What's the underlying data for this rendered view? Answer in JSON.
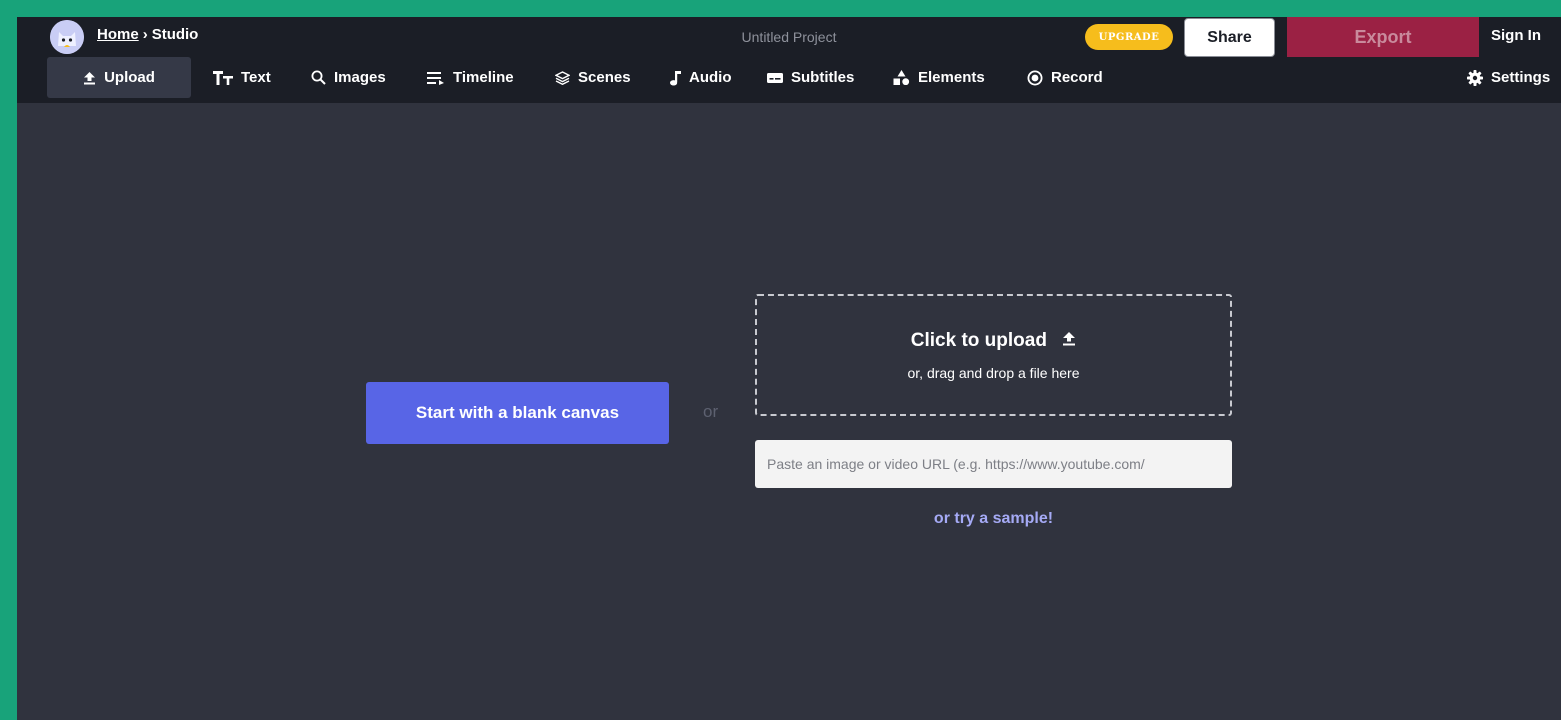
{
  "header": {
    "breadcrumb": {
      "home": "Home",
      "separator": "›",
      "current": "Studio"
    },
    "project_title": "Untitled Project",
    "upgrade_label": "UPGRADE",
    "share_label": "Share",
    "export_label": "Export",
    "signin_label": "Sign In"
  },
  "toolbar": {
    "items": [
      {
        "label": "Upload",
        "icon": "upload-icon",
        "active": true
      },
      {
        "label": "Text",
        "icon": "text-icon"
      },
      {
        "label": "Images",
        "icon": "search-icon"
      },
      {
        "label": "Timeline",
        "icon": "timeline-icon"
      },
      {
        "label": "Scenes",
        "icon": "layers-icon"
      },
      {
        "label": "Audio",
        "icon": "music-note-icon"
      },
      {
        "label": "Subtitles",
        "icon": "subtitles-icon"
      },
      {
        "label": "Elements",
        "icon": "shapes-icon"
      },
      {
        "label": "Record",
        "icon": "record-icon"
      }
    ],
    "settings_label": "Settings"
  },
  "main": {
    "blank_canvas_label": "Start with a blank canvas",
    "or_label": "or",
    "dropzone": {
      "title": "Click to upload",
      "subtitle": "or, drag and drop a file here"
    },
    "url_input": {
      "placeholder": "Paste an image or video URL (e.g. https://www.youtube.com/",
      "value": ""
    },
    "sample_link": "or try a sample!"
  },
  "colors": {
    "frame_border": "#18a37a",
    "header_bg": "#1b1e26",
    "canvas_bg": "#30333e",
    "primary": "#5865e6",
    "export": "#9b2144",
    "upgrade": "#f6bd1c",
    "link": "#a5aaf5"
  }
}
